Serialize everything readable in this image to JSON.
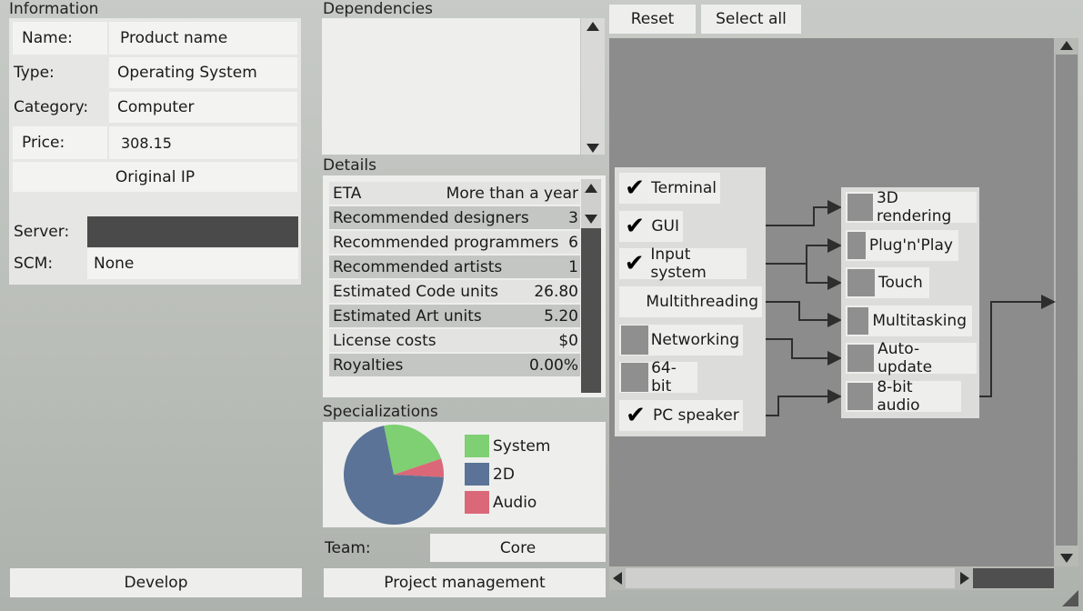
{
  "info": {
    "title": "Information",
    "name_label": "Name:",
    "name_value": "Product name",
    "type_label": "Type:",
    "type_value": "Operating System",
    "category_label": "Category:",
    "category_value": "Computer",
    "price_label": "Price:",
    "price_value": "308.15",
    "ip_value": "Original IP",
    "server_label": "Server:",
    "server_value": "",
    "scm_label": "SCM:",
    "scm_value": "None",
    "develop_button": "Develop"
  },
  "dependencies": {
    "title": "Dependencies"
  },
  "details": {
    "title": "Details",
    "rows": [
      {
        "label": "ETA",
        "value": "More than a year"
      },
      {
        "label": "Recommended designers",
        "value": "3"
      },
      {
        "label": "Recommended programmers",
        "value": "6"
      },
      {
        "label": "Recommended artists",
        "value": "1"
      },
      {
        "label": "Estimated Code units",
        "value": "26.80"
      },
      {
        "label": "Estimated Art units",
        "value": "5.20"
      },
      {
        "label": "License costs",
        "value": "$0"
      },
      {
        "label": "Royalties",
        "value": "0.00%"
      }
    ]
  },
  "specializations": {
    "title": "Specializations",
    "legend": [
      {
        "label": "System",
        "color": "#7fcf73"
      },
      {
        "label": "2D",
        "color": "#5a7396"
      },
      {
        "label": "Audio",
        "color": "#db6878"
      }
    ]
  },
  "chart_data": {
    "type": "pie",
    "slices": [
      {
        "label": "System",
        "value": 0.23,
        "color": "#7fcf73"
      },
      {
        "label": "Audio",
        "value": 0.06,
        "color": "#db6878"
      },
      {
        "label": "2D",
        "value": 0.71,
        "color": "#5a7396"
      }
    ]
  },
  "team": {
    "label": "Team:",
    "value": "Core"
  },
  "project_button": "Project management",
  "toolbar": {
    "reset": "Reset",
    "select_all": "Select all"
  },
  "features": [
    {
      "label": "Terminal",
      "state": "checked"
    },
    {
      "label": "GUI",
      "state": "checked"
    },
    {
      "label": "Input system",
      "state": "checked"
    },
    {
      "label": "Multithreading",
      "state": "blank"
    },
    {
      "label": "Networking",
      "state": "unchecked"
    },
    {
      "label": "64-bit",
      "state": "unchecked"
    },
    {
      "label": "PC speaker",
      "state": "checked"
    }
  ],
  "dependent_features": [
    {
      "label": "3D rendering"
    },
    {
      "label": "Plug'n'Play"
    },
    {
      "label": "Touch"
    },
    {
      "label": "Multitasking"
    },
    {
      "label": "Auto-update"
    },
    {
      "label": "8-bit audio"
    }
  ],
  "icons": {
    "check": "✔"
  }
}
